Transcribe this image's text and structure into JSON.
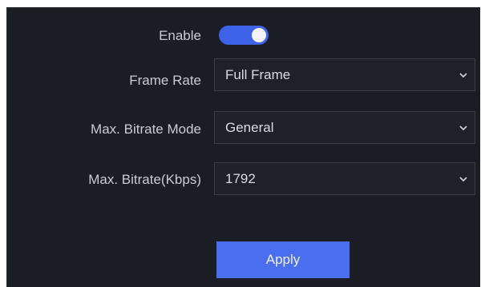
{
  "form": {
    "enable": {
      "label": "Enable",
      "on": true
    },
    "frame_rate": {
      "label": "Frame Rate",
      "value": "Full Frame"
    },
    "bitrate_mode": {
      "label": "Max. Bitrate Mode",
      "value": "General"
    },
    "max_bitrate": {
      "label": "Max. Bitrate(Kbps)",
      "value": "1792"
    }
  },
  "actions": {
    "apply_label": "Apply"
  },
  "colors": {
    "panel_bg": "#1a1d24",
    "accent": "#3d63e8",
    "button": "#4a6ef0",
    "label_text": "#c9ccd2"
  },
  "icons": {
    "dropdown": "chevron-down-icon"
  }
}
